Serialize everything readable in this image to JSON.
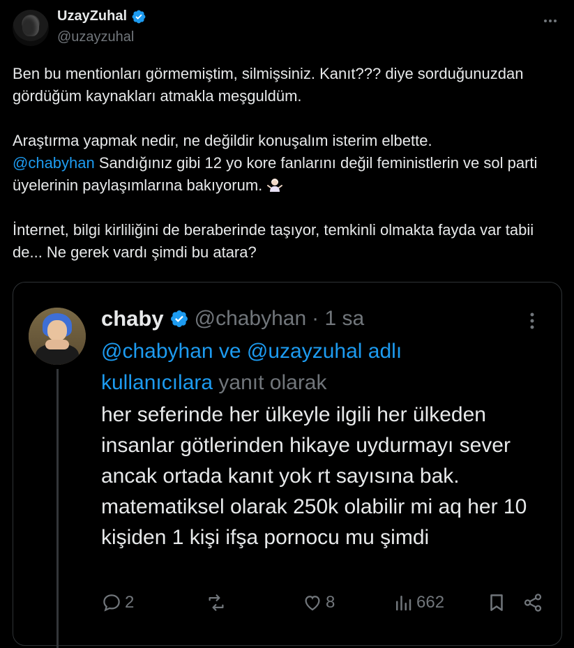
{
  "author": {
    "name": "UzayZuhal",
    "handle": "@uzayzuhal"
  },
  "post": {
    "p1": "Ben bu mentionları görmemiştim, silmişsiniz. Kanıt??? diye sorduğunuzdan gördüğüm kaynakları atmakla meşguldüm.",
    "p2_line1": "Araştırma yapmak nedir, ne değildir konuşalım isterim elbette.",
    "p2_mention": "@chabyhan",
    "p2_rest": "  Sandığınız gibi 12 yo kore fanlarını değil feministlerin ve sol parti üyelerinin paylaşımlarına bakıyorum.",
    "emoji": "woman-shrugging-emoji",
    "p3": "İnternet, bilgi kirliliğini de beraberinde taşıyor, temkinli olmakta fayda var tabii de... Ne gerek vardı şimdi bu atara?"
  },
  "quoted": {
    "name": "chaby",
    "handle": "@chabyhan",
    "time": "· 1 sa",
    "reply_mentions": "@chabyhan ve @uzayzuhal adlı kullanıcılara",
    "reply_suffix": " yanıt olarak",
    "text": "her seferinde her ülkeyle ilgili her ülkeden insanlar götlerinden hikaye uydurmayı sever ancak ortada kanıt yok rt sayısına bak. matematiksel olarak 250k olabilir mi aq her 10 kişiden 1 kişi ifşa pornocu mu şimdi",
    "replies": "2",
    "reposts": "",
    "likes": "8",
    "views": "662"
  },
  "colors": {
    "background": "#000000",
    "text": "#e7e9ea",
    "muted": "#71767b",
    "link": "#1d9bf0",
    "verified": "#1d9bf0",
    "border": "#2f3336"
  }
}
